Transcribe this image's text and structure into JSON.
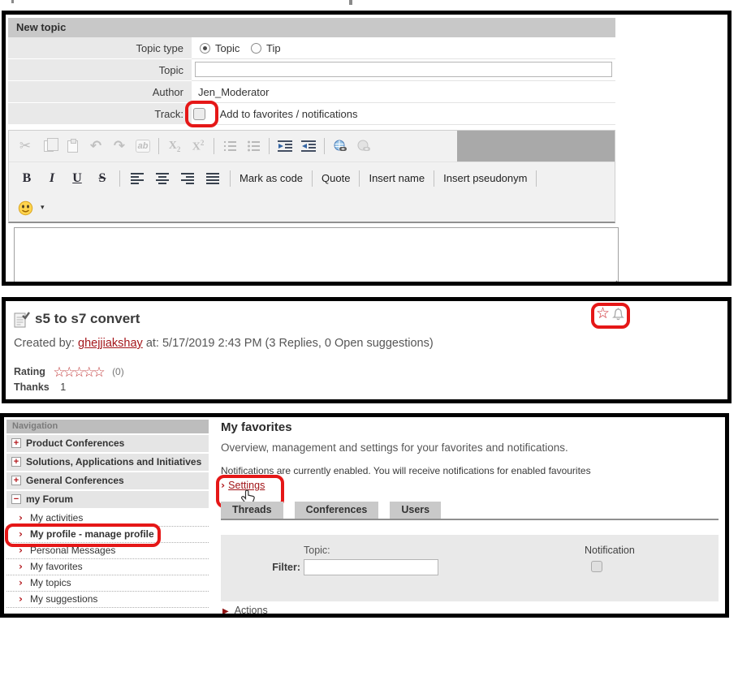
{
  "colors": {
    "highlight_red": "#e51717",
    "link_red": "#a4161b",
    "nav_red": "#b3181d",
    "star_red": "#bf3434",
    "tab_gray": "#c9c9c9",
    "panel_border": "#000000"
  },
  "icons": {
    "plus": "+",
    "minus": "−",
    "chevron": "›",
    "caret_down": "▾",
    "triangle_right": "▶",
    "star_outline": "☆",
    "cut": "✂",
    "undo": "↶",
    "redo": "↷",
    "stars_five": "☆☆☆☆☆"
  },
  "panel_new_topic": {
    "header": "New topic",
    "topic_type": {
      "label": "Topic type",
      "options": [
        {
          "label": "Topic",
          "selected": true
        },
        {
          "label": "Tip",
          "selected": false
        }
      ]
    },
    "topic": {
      "label": "Topic",
      "value": ""
    },
    "author": {
      "label": "Author",
      "value": "Jen_Moderator"
    },
    "track": {
      "label": "Track:",
      "checked": false,
      "option_label": "Add to favorites / notifications"
    },
    "toolbar": {
      "row1_icons": [
        "cut",
        "copy",
        "paste",
        "undo",
        "redo",
        "replace",
        "subscript",
        "superscript",
        "numbered-list",
        "bullet-list",
        "indent",
        "outdent",
        "link",
        "unlink"
      ],
      "bold": "B",
      "italic": "I",
      "underline": "U",
      "strike": "S",
      "subscript": "X",
      "superscript": "X",
      "custom_buttons": [
        "Mark as code",
        "Quote",
        "Insert name",
        "Insert pseudonym"
      ],
      "smiley_tooltip": "smiley"
    },
    "body_value": ""
  },
  "panel_topic_header": {
    "title": "s5 to s7 convert",
    "created_by_label": "Created by:",
    "author_link": "ghejjiakshay",
    "created_details": " at: 5/17/2019 2:43 PM (3 Replies, 0 Open suggestions)",
    "rating_label": "Rating",
    "rating_count": "(0)",
    "thanks_label": "Thanks",
    "thanks_value": "1"
  },
  "panel_my_favorites": {
    "nav_header": "Navigation",
    "nav_sections": [
      {
        "label": "Product Conferences",
        "expanded": false
      },
      {
        "label": "Solutions, Applications and Initiatives",
        "expanded": false
      },
      {
        "label": "General Conferences",
        "expanded": false
      },
      {
        "label": "my Forum",
        "expanded": true
      }
    ],
    "nav_subitems": [
      "My activities",
      "My profile - manage profile",
      "Personal Messages",
      "My favorites",
      "My topics",
      "My suggestions"
    ],
    "main": {
      "title": "My favorites",
      "description": "Overview, management and settings for your favorites and notifications.",
      "note": "Notifications are currently enabled. You will receive notifications for enabled favourites",
      "settings_label": "Settings",
      "tabs": [
        "Threads",
        "Conferences",
        "Users"
      ],
      "active_tab": "Threads",
      "filter": {
        "column_label": "Topic:",
        "filter_label": "Filter:",
        "input_value": "",
        "notification_label": "Notification",
        "notification_checked": false
      },
      "actions_label": "Actions"
    }
  }
}
